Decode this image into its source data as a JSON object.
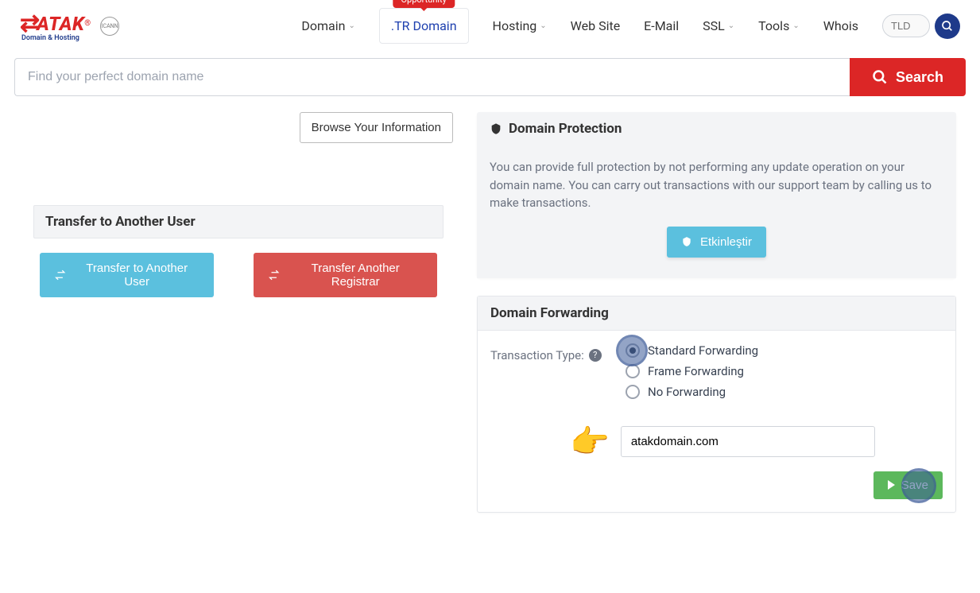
{
  "header": {
    "logo_main": "ATAK",
    "logo_sub": "Domain & Hosting",
    "logo_icann": "ICANN",
    "nav": {
      "domain": "Domain",
      "tr_domain": ".TR Domain",
      "tr_badge": "Opportunity",
      "hosting": "Hosting",
      "website": "Web Site",
      "email": "E-Mail",
      "ssl": "SSL",
      "tools": "Tools",
      "whois": "Whois"
    },
    "tld_placeholder": "TLD"
  },
  "search": {
    "placeholder": "Find your perfect domain name",
    "button": "Search"
  },
  "browse_info": "Browse Your Information",
  "transfer": {
    "title": "Transfer to Another User",
    "btn_user": "Transfer to Another User",
    "btn_registrar": "Transfer Another Registrar"
  },
  "protection": {
    "title": "Domain Protection",
    "text": "You can provide full protection by not performing any update operation on your domain name. You can carry out transactions with our support team by calling us to make transactions.",
    "enable": "Etkinleştir"
  },
  "forwarding": {
    "title": "Domain Forwarding",
    "label": "Transaction Type:",
    "options": {
      "standard": "Standard Forwarding",
      "frame": "Frame Forwarding",
      "none": "No Forwarding"
    },
    "domain_value": "atakdomain.com",
    "save": "Save"
  }
}
